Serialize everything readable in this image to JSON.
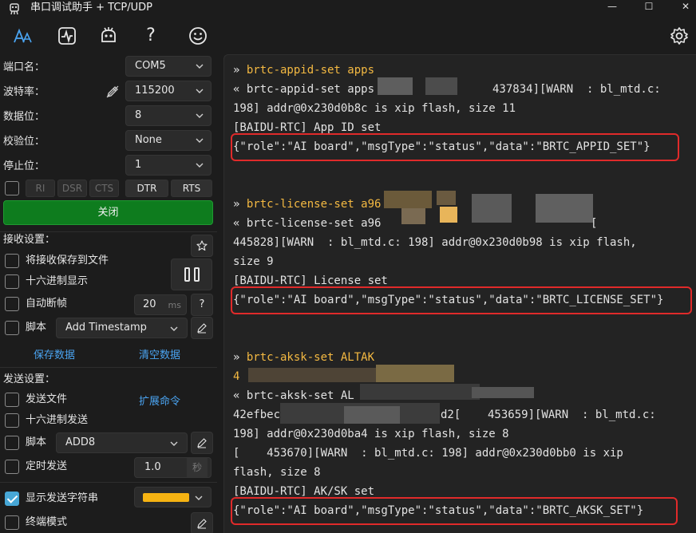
{
  "window": {
    "title": "串口调试助手 + TCP/UDP",
    "minimize_glyph": "—",
    "maximize_glyph": "☐",
    "close_glyph": "✕"
  },
  "toolbar": {
    "items": [
      "font-size-icon",
      "waveform-icon",
      "bot-icon",
      "help-icon",
      "smiley-icon"
    ],
    "help_glyph": "?",
    "settings_icon": "gear-icon"
  },
  "serial": {
    "port_label": "端口名：",
    "port_value": "COM5",
    "baud_label": "波特率：",
    "baud_value": "115200",
    "databits_label": "数据位：",
    "databits_value": "8",
    "parity_label": "校验位：",
    "parity_value": "None",
    "stopbits_label": "停止位：",
    "stopbits_value": "1",
    "flow": {
      "ri": "RI",
      "dsr": "DSR",
      "cts": "CTS",
      "dtr": "DTR",
      "rts": "RTS"
    },
    "close_button": "关闭"
  },
  "receive": {
    "section_label": "接收设置：",
    "save_to_file": "将接收保存到文件",
    "hex_display": "十六进制显示",
    "auto_frame": "自动断帧",
    "auto_frame_value": "20",
    "auto_frame_unit": "ms",
    "auto_frame_help": "?",
    "script_label": "脚本",
    "script_value": "Add Timestamp",
    "save_data": "保存数据",
    "clear_data": "清空数据"
  },
  "send": {
    "section_label": "发送设置：",
    "send_file": "发送文件",
    "extend_cmd": "扩展命令",
    "hex_send": "十六进制发送",
    "script_label": "脚本",
    "script_value": "ADD8",
    "timed_send": "定时发送",
    "timed_value": "1.0",
    "timed_unit": "秒",
    "show_send_string": "显示发送字符串",
    "send_color": "#f6b312",
    "terminal_mode": "终端模式"
  },
  "terminal": {
    "lines": [
      {
        "kind": "cmd",
        "text": "brtc-appid-set apps"
      },
      {
        "kind": "out",
        "text": "« brtc-appid-set apps"
      },
      {
        "kind": "out",
        "text": "437834][WARN  : bl_mtd.c:"
      },
      {
        "kind": "out",
        "text": "198] addr@0x230d0b8c is xip flash, size 11"
      },
      {
        "kind": "out",
        "text": "[BAIDU-RTC] App ID set"
      },
      {
        "kind": "json",
        "text": "{\"role\":\"AI board\",\"msgType\":\"status\",\"data\":\"BRTC_APPID_SET\"}"
      },
      {
        "kind": "cmd",
        "text": "brtc-license-set a96"
      },
      {
        "kind": "out",
        "text": "« brtc-license-set a96"
      },
      {
        "kind": "out",
        "text": "["
      },
      {
        "kind": "out",
        "text": "445828][WARN  : bl_mtd.c: 198] addr@0x230d0b98 is xip flash,"
      },
      {
        "kind": "out",
        "text": "size 9"
      },
      {
        "kind": "out",
        "text": "[BAIDU-RTC] License set"
      },
      {
        "kind": "json",
        "text": "{\"role\":\"AI board\",\"msgType\":\"status\",\"data\":\"BRTC_LICENSE_SET\"}"
      },
      {
        "kind": "cmd",
        "text": "brtc-aksk-set ALTAK"
      },
      {
        "kind": "out",
        "text": "4"
      },
      {
        "kind": "out",
        "text": "« brtc-aksk-set AL"
      },
      {
        "kind": "out",
        "text": "42efbec"
      },
      {
        "kind": "out",
        "text": "d2[    453659][WARN  : bl_mtd.c:"
      },
      {
        "kind": "out",
        "text": "198] addr@0x230d0ba4 is xip flash, size 8"
      },
      {
        "kind": "out",
        "text": "[    453670][WARN  : bl_mtd.c: 198] addr@0x230d0bb0 is xip"
      },
      {
        "kind": "out",
        "text": "flash, size 8"
      },
      {
        "kind": "out",
        "text": "[BAIDU-RTC] AK/SK set"
      },
      {
        "kind": "json",
        "text": "{\"role\":\"AI board\",\"msgType\":\"status\",\"data\":\"BRTC_AKSK_SET\"}"
      }
    ],
    "prompt_glyph": "» ",
    "highlight_color": "#e02a2a"
  }
}
